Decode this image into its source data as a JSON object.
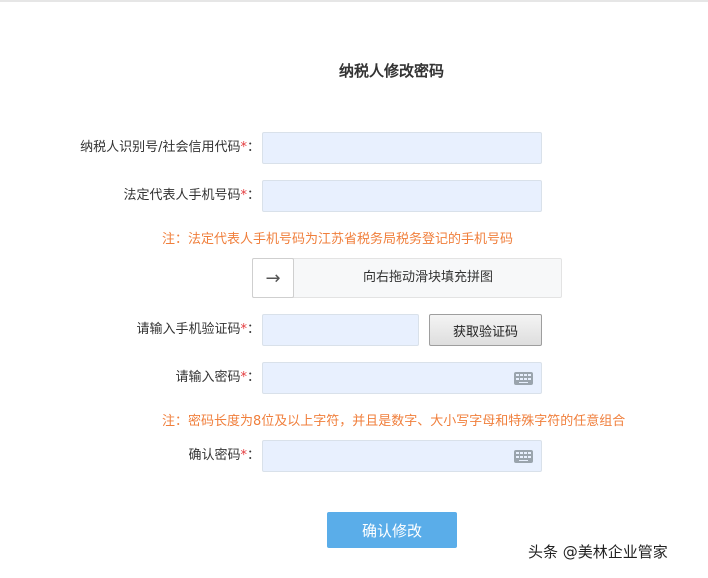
{
  "page": {
    "title": "纳税人修改密码"
  },
  "fields": {
    "taxpayer_id": {
      "label": "纳税人识别号/社会信用代码",
      "required_mark": "*",
      "colon": "：",
      "value": "",
      "placeholder": ""
    },
    "legal_rep_phone": {
      "label": "法定代表人手机号码",
      "required_mark": "*",
      "colon": "：",
      "value": "",
      "placeholder": ""
    },
    "sms_code": {
      "label": "请输入手机验证码",
      "required_mark": "*",
      "colon": "：",
      "value": "",
      "placeholder": ""
    },
    "password": {
      "label": "请输入密码",
      "required_mark": "*",
      "colon": "：",
      "value": "",
      "placeholder": ""
    },
    "confirm_password": {
      "label": "确认密码",
      "required_mark": "*",
      "colon": "：",
      "value": "",
      "placeholder": ""
    }
  },
  "notes": {
    "phone_note": "注：法定代表人手机号码为江苏省税务局税务登记的手机号码",
    "password_note": "注：密码长度为8位及以上字符，并且是数字、大小写字母和特殊字符的任意组合"
  },
  "slider": {
    "handle_symbol": "→",
    "text": "向右拖动滑块填充拼图"
  },
  "buttons": {
    "get_code": "获取验证码",
    "submit": "确认修改"
  },
  "watermark": {
    "text": "头条 @美林企业管家"
  },
  "colors": {
    "required": "#e4393c",
    "note": "#f07f3c",
    "submit_bg": "#5aade9",
    "input_bg": "#e8f0fe"
  },
  "icons": {
    "password_keyboard": "keyboard-icon",
    "slider_handle": "arrow-right-icon"
  }
}
